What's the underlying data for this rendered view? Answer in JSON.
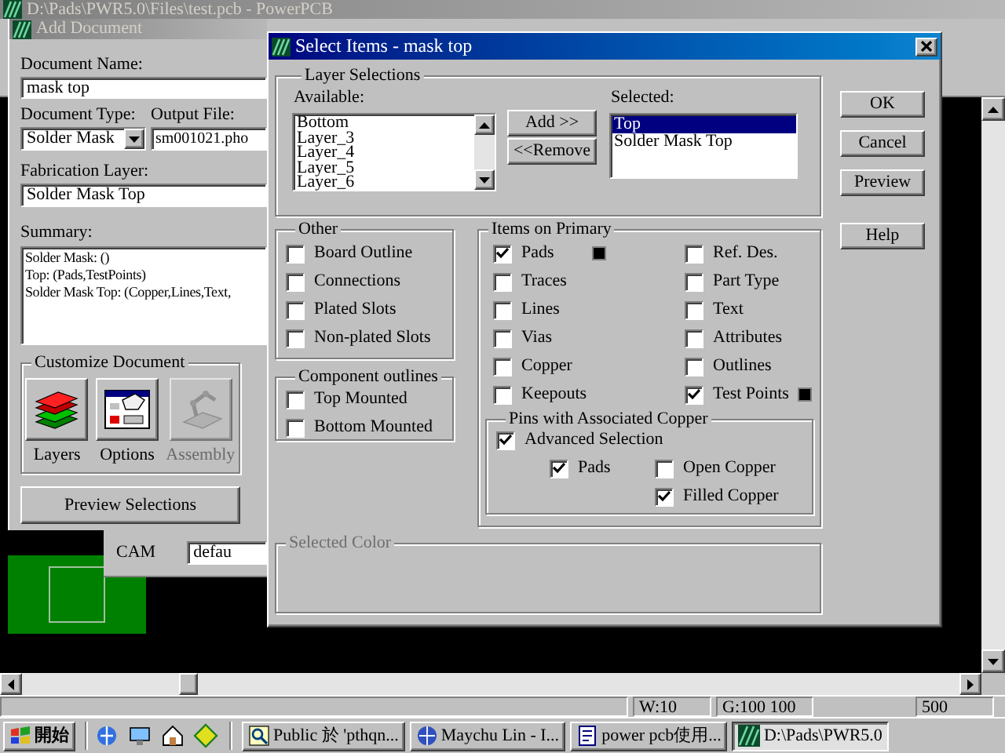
{
  "main_window": {
    "title": "D:\\Pads\\PWR5.0\\Files\\test.pcb - PowerPCB",
    "active": false,
    "status_bar": [
      "W:10",
      "G:100 100",
      "500"
    ]
  },
  "add_document": {
    "title": "Add Document",
    "active": false,
    "document_name": {
      "label": "Document Name:",
      "value": "mask top"
    },
    "document_type": {
      "label": "Document Type:",
      "value": "Solder Mask"
    },
    "output_file": {
      "label": "Output File:",
      "value": "sm001021.pho"
    },
    "fabrication_layer": {
      "label": "Fabrication Layer:",
      "value": "Solder Mask Top"
    },
    "summary": {
      "label": "Summary:",
      "lines": [
        "Solder Mask: ()",
        "Top: (Pads,TestPoints)",
        "Solder Mask Top: (Copper,Lines,Text,"
      ]
    },
    "customize_document": {
      "title": "Customize Document",
      "buttons": [
        {
          "label": "Layers",
          "kind": "layers",
          "disabled": false
        },
        {
          "label": "Options",
          "kind": "options",
          "disabled": false
        },
        {
          "label": "Assembly",
          "kind": "assembly",
          "disabled": true
        }
      ]
    },
    "preview_button": "Preview Selections"
  },
  "cam_panel": {
    "label": "CAM",
    "value": "defau"
  },
  "select_items": {
    "title": "Select Items - mask top",
    "active": true,
    "layer_selections": {
      "title": "Layer Selections",
      "available_label": "Available:",
      "available": [
        {
          "label": "Bottom",
          "selected": false
        },
        {
          "label": "Layer_3",
          "selected": false
        },
        {
          "label": "Layer_4",
          "selected": false
        },
        {
          "label": "Layer_5",
          "selected": false
        },
        {
          "label": "Layer_6",
          "selected": false
        }
      ],
      "add_button": "Add >>",
      "remove_button": "<<Remove",
      "selected_label": "Selected:",
      "selected": [
        {
          "label": "Top",
          "selected": true
        },
        {
          "label": "Solder Mask Top",
          "selected": false
        }
      ]
    },
    "other": {
      "title": "Other",
      "items": [
        {
          "label": "Board Outline",
          "checked": false
        },
        {
          "label": "Connections",
          "checked": false
        },
        {
          "label": "Plated Slots",
          "checked": false
        },
        {
          "label": "Non-plated Slots",
          "checked": false
        }
      ]
    },
    "component_outlines": {
      "title": "Component outlines",
      "items": [
        {
          "label": "Top Mounted",
          "checked": false
        },
        {
          "label": "Bottom Mounted",
          "checked": false
        }
      ]
    },
    "items_on_primary": {
      "title": "Items on Primary",
      "items": [
        {
          "label": "Pads",
          "checked": true,
          "color": "#000000"
        },
        {
          "label": "Traces",
          "checked": false
        },
        {
          "label": "Lines",
          "checked": false
        },
        {
          "label": "Vias",
          "checked": false
        },
        {
          "label": "Copper",
          "checked": false
        },
        {
          "label": "Keepouts",
          "checked": false
        },
        {
          "label": "Ref. Des.",
          "checked": false
        },
        {
          "label": "Part Type",
          "checked": false
        },
        {
          "label": "Text",
          "checked": false
        },
        {
          "label": "Attributes",
          "checked": false
        },
        {
          "label": "Outlines",
          "checked": false
        },
        {
          "label": "Test Points",
          "checked": true,
          "color": "#000000"
        }
      ]
    },
    "pins": {
      "title": "Pins with Associated Copper",
      "advanced_selection": {
        "label": "Advanced Selection",
        "checked": true
      },
      "items": [
        {
          "label": "Pads",
          "checked": true
        },
        {
          "label": "Open Copper",
          "checked": false
        },
        {
          "label": "Filled Copper",
          "checked": true
        }
      ]
    },
    "selected_color": {
      "title": "Selected Color",
      "disabled": true
    },
    "buttons": [
      "OK",
      "Cancel",
      "Preview",
      "Help"
    ]
  },
  "taskbar": {
    "start": "開始",
    "tasks": [
      {
        "label": "Public 於 'pthqn...",
        "kind": "search",
        "selected": false
      },
      {
        "label": "Maychu Lin - I...",
        "kind": "browser",
        "selected": false
      },
      {
        "label": "power pcb使用...",
        "kind": "word",
        "selected": false
      },
      {
        "label": "D:\\Pads\\PWR5.0",
        "kind": "pcb",
        "selected": true
      }
    ]
  }
}
